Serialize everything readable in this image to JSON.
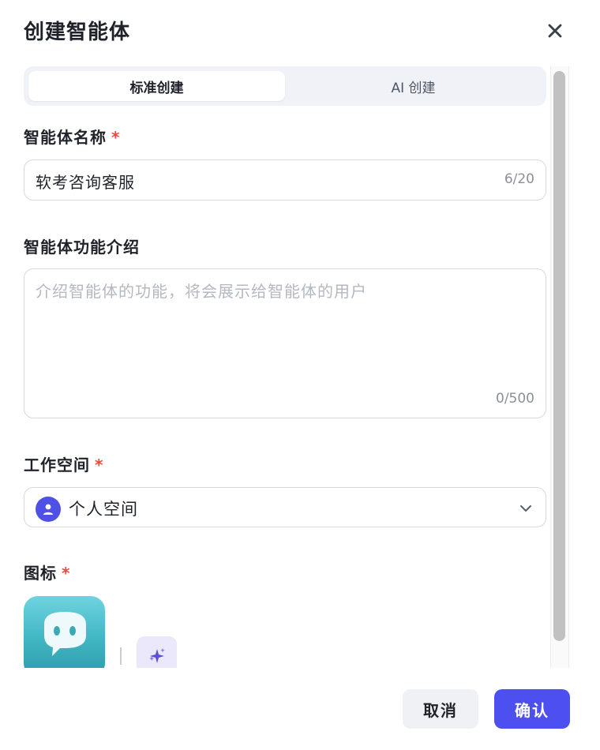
{
  "dialog": {
    "title": "创建智能体",
    "close_icon": "close-icon"
  },
  "tabs": [
    {
      "label": "标准创建",
      "active": true
    },
    {
      "label": "AI 创建",
      "active": false
    }
  ],
  "name_field": {
    "label": "智能体名称",
    "required_mark": "*",
    "value": "软考咨询客服",
    "counter": "6/20"
  },
  "description_field": {
    "label": "智能体功能介绍",
    "placeholder": "介绍智能体的功能，将会展示给智能体的用户",
    "counter": "0/500"
  },
  "workspace_field": {
    "label": "工作空间",
    "required_mark": "*",
    "selected": "个人空间",
    "avatar_icon": "user-icon",
    "chevron_icon": "chevron-down-icon"
  },
  "icon_field": {
    "label": "图标",
    "required_mark": "*",
    "preview_icon": "chat-bot-icon",
    "generate_icon": "sparkle-icon"
  },
  "footer": {
    "cancel_label": "取消",
    "confirm_label": "确认"
  },
  "colors": {
    "accent": "#4d4ff0",
    "required": "#f0483e",
    "icon_gradient_top": "#6fd3e0",
    "icon_gradient_bottom": "#2f9aa8"
  }
}
